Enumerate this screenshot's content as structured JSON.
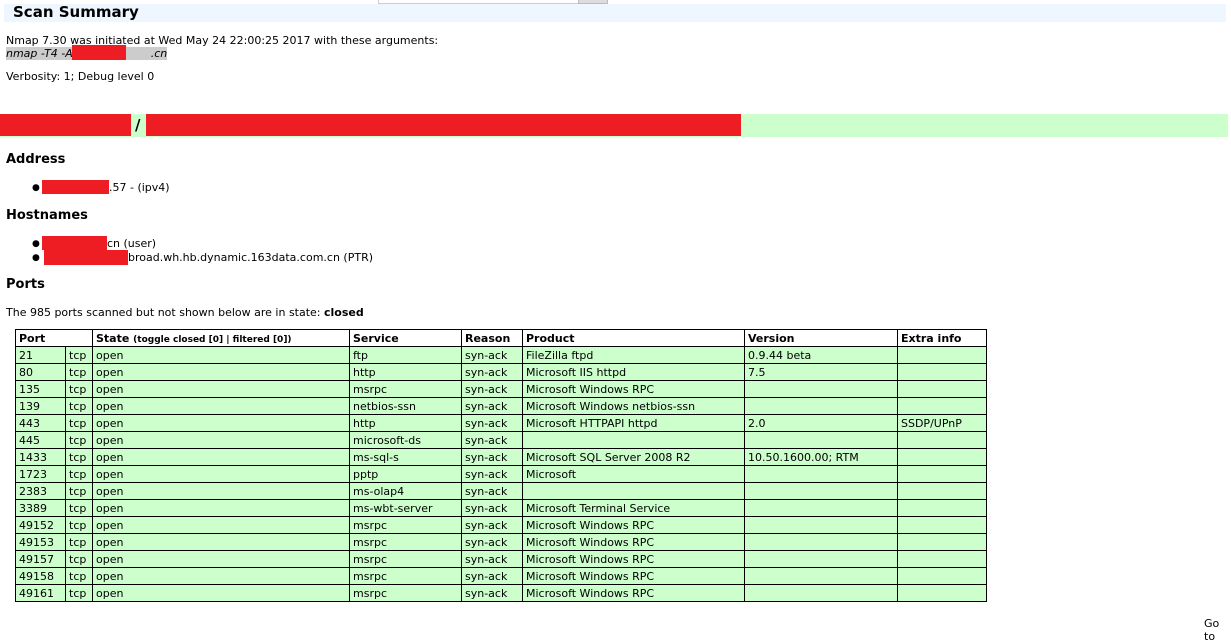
{
  "header": {
    "title": "Scan Summary"
  },
  "summary": {
    "line1": "Nmap 7.30 was initiated at Wed May 24 22:00:25 2017 with these arguments:",
    "args_prefix": "nmap -T4 -A -v",
    "args_suffix": ".cn",
    "verbosity": "Verbosity: 1; Debug level 0"
  },
  "host": {
    "separator": "/"
  },
  "address": {
    "heading": "Address",
    "item_suffix": ".57 - (ipv4)"
  },
  "hostnames": {
    "heading": "Hostnames",
    "items": [
      "cn (user)",
      "broad.wh.hb.dynamic.163data.com.cn (PTR)"
    ]
  },
  "ports": {
    "heading": "Ports",
    "note_prefix": "The 985 ports scanned but not shown below are in state: ",
    "note_state": "closed"
  },
  "table": {
    "headers": {
      "port": "Port",
      "state": "State",
      "state_toggle": "(toggle closed [0] | filtered [0])",
      "service": "Service",
      "reason": "Reason",
      "product": "Product",
      "version": "Version",
      "extra": "Extra info"
    },
    "rows": [
      [
        "21",
        "tcp",
        "open",
        "ftp",
        "syn-ack",
        "FileZilla ftpd",
        "0.9.44 beta",
        ""
      ],
      [
        "80",
        "tcp",
        "open",
        "http",
        "syn-ack",
        "Microsoft IIS httpd",
        "7.5",
        ""
      ],
      [
        "135",
        "tcp",
        "open",
        "msrpc",
        "syn-ack",
        "Microsoft Windows RPC",
        "",
        ""
      ],
      [
        "139",
        "tcp",
        "open",
        "netbios-ssn",
        "syn-ack",
        "Microsoft Windows netbios-ssn",
        "",
        ""
      ],
      [
        "443",
        "tcp",
        "open",
        "http",
        "syn-ack",
        "Microsoft HTTPAPI httpd",
        "2.0",
        "SSDP/UPnP"
      ],
      [
        "445",
        "tcp",
        "open",
        "microsoft-ds",
        "syn-ack",
        "",
        "",
        ""
      ],
      [
        "1433",
        "tcp",
        "open",
        "ms-sql-s",
        "syn-ack",
        "Microsoft SQL Server 2008 R2",
        "10.50.1600.00; RTM",
        ""
      ],
      [
        "1723",
        "tcp",
        "open",
        "pptp",
        "syn-ack",
        "Microsoft",
        "",
        ""
      ],
      [
        "2383",
        "tcp",
        "open",
        "ms-olap4",
        "syn-ack",
        "",
        "",
        ""
      ],
      [
        "3389",
        "tcp",
        "open",
        "ms-wbt-server",
        "syn-ack",
        "Microsoft Terminal Service",
        "",
        ""
      ],
      [
        "49152",
        "tcp",
        "open",
        "msrpc",
        "syn-ack",
        "Microsoft Windows RPC",
        "",
        ""
      ],
      [
        "49153",
        "tcp",
        "open",
        "msrpc",
        "syn-ack",
        "Microsoft Windows RPC",
        "",
        ""
      ],
      [
        "49157",
        "tcp",
        "open",
        "msrpc",
        "syn-ack",
        "Microsoft Windows RPC",
        "",
        ""
      ],
      [
        "49158",
        "tcp",
        "open",
        "msrpc",
        "syn-ack",
        "Microsoft Windows RPC",
        "",
        ""
      ],
      [
        "49161",
        "tcp",
        "open",
        "msrpc",
        "syn-ack",
        "Microsoft Windows RPC",
        "",
        ""
      ]
    ]
  },
  "footer": {
    "goto": "Go to"
  }
}
